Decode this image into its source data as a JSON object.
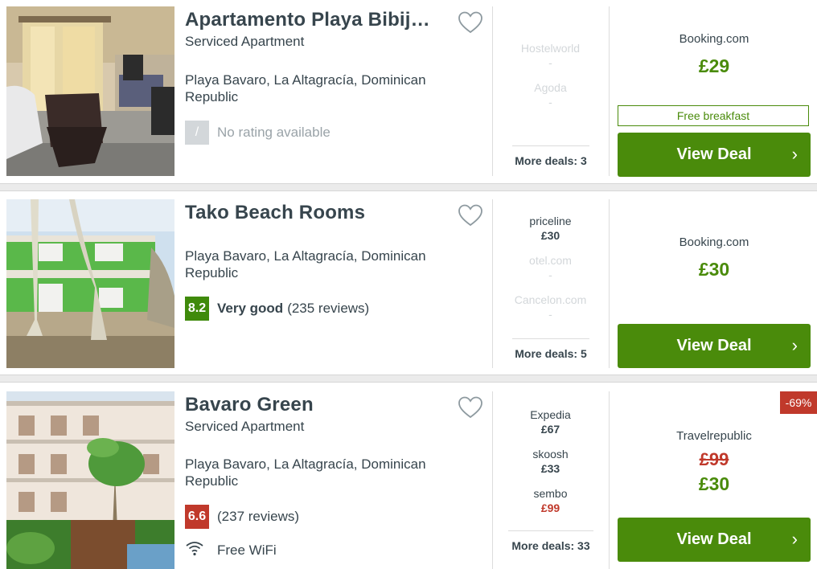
{
  "colors": {
    "accent_green": "#4a8b0b",
    "rating_good": "#3f8a0b",
    "rating_avg": "#c0392b",
    "discount_red": "#c0392b"
  },
  "hotels": [
    {
      "name": "Apartamento Playa Bibij…",
      "type": "Serviced Apartment",
      "location": "Playa Bavaro, La Altagracía, Dominican Republic",
      "rating_badge": "/",
      "rating_text": "No rating available",
      "deals": [
        {
          "provider": "Hostelworld",
          "price": "-"
        },
        {
          "provider": "Agoda",
          "price": "-"
        }
      ],
      "more_deals": "More deals: 3",
      "best_provider": "Booking.com",
      "best_price": "£29",
      "perk": "Free breakfast",
      "button": "View Deal"
    },
    {
      "name": "Tako Beach Rooms",
      "location": "Playa Bavaro, La Altagracía, Dominican Republic",
      "rating_badge": "8.2",
      "rating_label": "Very good",
      "rating_reviews": "(235 reviews)",
      "deals": [
        {
          "provider": "priceline",
          "price": "£30"
        },
        {
          "provider": "otel.com",
          "price": "-"
        },
        {
          "provider": "Cancelon.com",
          "price": "-"
        }
      ],
      "more_deals": "More deals: 5",
      "best_provider": "Booking.com",
      "best_price": "£30",
      "button": "View Deal"
    },
    {
      "name": "Bavaro Green",
      "type": "Serviced Apartment",
      "location": "Playa Bavaro, La Altagracía, Dominican Republic",
      "rating_badge": "6.6",
      "rating_reviews": "(237 reviews)",
      "amenity": "Free WiFi",
      "deals": [
        {
          "provider": "Expedia",
          "price": "£67"
        },
        {
          "provider": "skoosh",
          "price": "£33"
        },
        {
          "provider": "sembo",
          "price": "£99"
        }
      ],
      "more_deals": "More deals: 33",
      "discount": "-69%",
      "best_provider": "Travelrepublic",
      "old_price": "£99",
      "best_price": "£30",
      "button": "View Deal"
    }
  ]
}
